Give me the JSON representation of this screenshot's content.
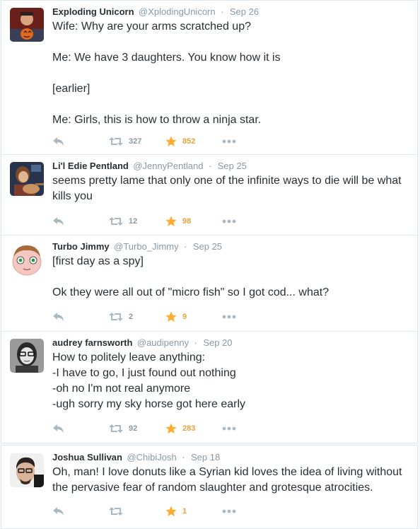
{
  "colors": {
    "muted": "#8899a6",
    "favorite": "#ffac33",
    "text": "#292f33"
  },
  "tweets": [
    {
      "name": "Exploding Unicorn",
      "handle": "@XplodingUnicorn",
      "time": "Sep 26",
      "lines": [
        "Wife: Why are your arms scratched up?",
        "",
        "Me: We have 3 daughters. You know how it is",
        "",
        "[earlier]",
        "",
        "Me: Girls, this is how to throw a ninja star."
      ],
      "retweets": "327",
      "favorites": "852"
    },
    {
      "name": "Li'l Edie Pentland",
      "handle": "@JennyPentland",
      "time": "Sep 25",
      "lines": [
        "seems pretty lame that only one of the infinite ways to die will be what",
        "kills you"
      ],
      "retweets": "12",
      "favorites": "98"
    },
    {
      "name": "Turbo Jimmy",
      "handle": "@Turbo_Jimmy",
      "time": "Sep 25",
      "lines": [
        "[first day as a spy]",
        "",
        "Ok they were all out of \"micro fish\" so I got cod... what?"
      ],
      "retweets": "2",
      "favorites": "9"
    },
    {
      "name": "audrey farnsworth",
      "handle": "@audipenny",
      "time": "Sep 20",
      "lines": [
        "How to politely leave anything:",
        "-I have to go, I just found out nothing",
        "-oh no I'm not real anymore",
        "-ugh sorry my sky horse got here early"
      ],
      "retweets": "92",
      "favorites": "283"
    },
    {
      "name": "Joshua Sullivan",
      "handle": "@ChibiJosh",
      "time": "Sep 18",
      "lines": [
        "Oh, man! I love donuts like a Syrian kid loves the idea of living without",
        "the pervasive fear of random slaughter and grotesque atrocities."
      ],
      "retweets": "",
      "favorites": "1"
    }
  ]
}
